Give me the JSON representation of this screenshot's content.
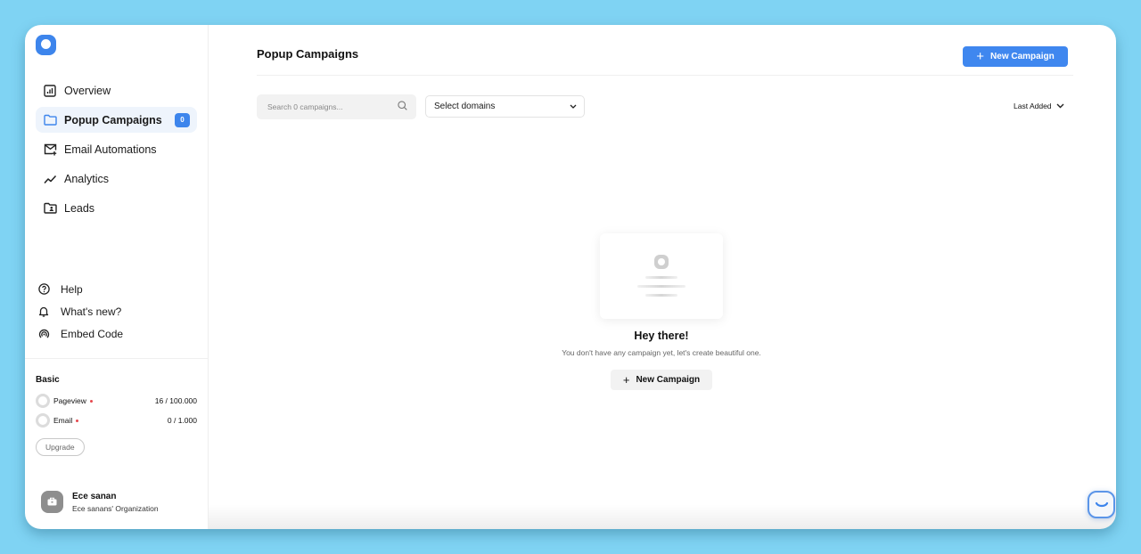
{
  "app": {
    "logo": "brand-logo",
    "accent_color": "#3f87ef",
    "background_color": "#7fd3f3"
  },
  "sidebar": {
    "nav": [
      {
        "label": "Overview",
        "icon": "chart-box-icon",
        "active": false
      },
      {
        "label": "Popup Campaigns",
        "icon": "folder-icon",
        "active": true,
        "badge": "0"
      },
      {
        "label": "Email Automations",
        "icon": "mail-plus-icon",
        "active": false
      },
      {
        "label": "Analytics",
        "icon": "trend-line-icon",
        "active": false
      },
      {
        "label": "Leads",
        "icon": "folder-user-icon",
        "active": false
      }
    ],
    "secondary": [
      {
        "label": "Help",
        "icon": "help-circle-icon"
      },
      {
        "label": "What's new?",
        "icon": "bell-icon"
      },
      {
        "label": "Embed Code",
        "icon": "broadcast-icon"
      }
    ],
    "plan": {
      "title": "Basic",
      "usage": [
        {
          "label": "Pageview",
          "value": "16 / 100.000"
        },
        {
          "label": "Email",
          "value": "0 / 1.000"
        }
      ],
      "upgrade_label": "Upgrade"
    },
    "user": {
      "name": "Ece sanan",
      "organization": "Ece sanans' Organization",
      "avatar_icon": "briefcase-icon"
    }
  },
  "main": {
    "title": "Popup Campaigns",
    "new_campaign_label": "New Campaign",
    "search": {
      "placeholder": "Search 0 campaigns...",
      "value": ""
    },
    "domain_select": {
      "selected": "Select domains"
    },
    "sort": {
      "selected": "Last Added"
    },
    "empty_state": {
      "title": "Hey there!",
      "subtitle": "You don't have any campaign yet, let's create beautiful one.",
      "button_label": "New Campaign"
    }
  },
  "chat_widget": {
    "icon": "smile-chat-icon"
  }
}
